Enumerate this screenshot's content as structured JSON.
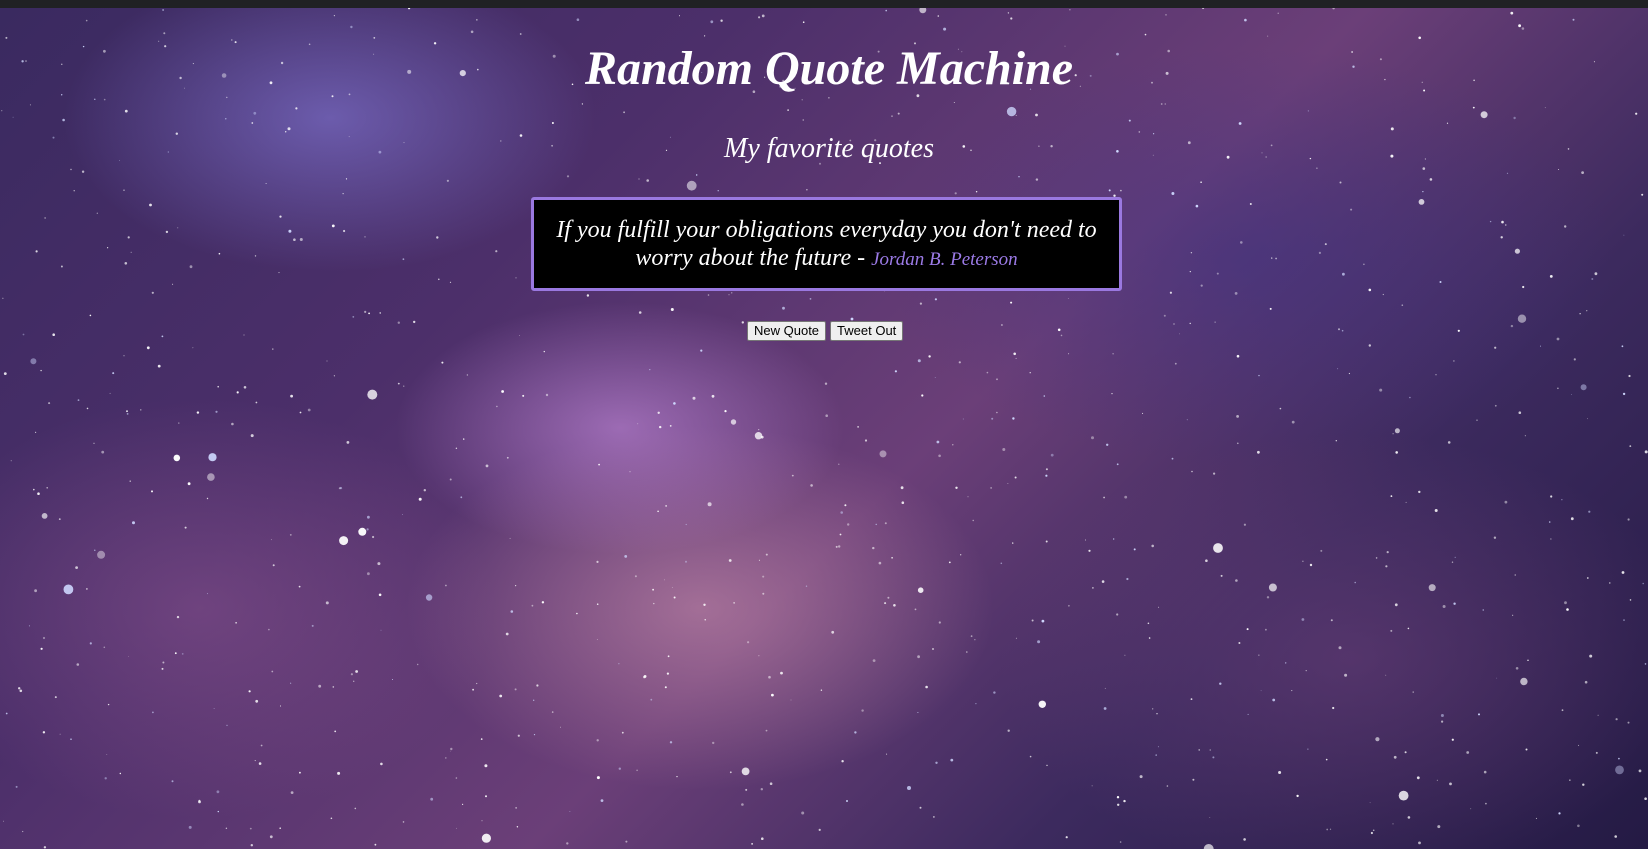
{
  "page": {
    "title": "Random Quote Machine",
    "subtitle": "My favorite quotes"
  },
  "quote": {
    "text": "If you fulfill your obligations everyday you don't need to worry about the future -",
    "author": "Jordan B. Peterson"
  },
  "buttons": {
    "new_quote": "New Quote",
    "tweet_out": "Tweet Out"
  },
  "colors": {
    "quote_border": "#9a78e0",
    "author_text": "#9b7ae6",
    "quote_background": "#000000",
    "heading_text": "#ffffff"
  }
}
